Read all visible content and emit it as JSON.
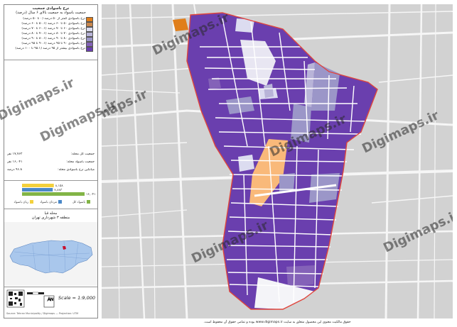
{
  "colors": {
    "map_background": "#d2d2d2",
    "roads": "#f6f6f6",
    "boundary": "#e0463d",
    "class_1": "#e07e1a",
    "class_2": "#c8874e",
    "class_3": "#dcdcf0",
    "class_4": "#b8b4d8",
    "class_5": "#9b96c8",
    "class_6": "#8462b8",
    "class_7": "#6a3fae",
    "built_up": "#ffffff",
    "orange_parcel": "#f9b97a",
    "bar_yellow": "#f3d03c",
    "bar_blue": "#4a88c8",
    "bar_green": "#82b446"
  },
  "legend": {
    "title": "نرخ باسوادی جمعیت",
    "subtitle": "جمعیت باسواد به جمعیت بالای ۶ سال (درصد)",
    "items": [
      {
        "label": "نرخ باسوادی کمتر از ۵۰ درصد (۰ تا ۵۰ درصد)",
        "color_key": "class_1"
      },
      {
        "label": "نرخ باسوادی ۵۰ تا ۶۰ درصد (۵۰.۱ تا ۶۰ درصد)",
        "color_key": "class_2"
      },
      {
        "label": "نرخ باسوادی ۶۰ تا ۷۰ درصد (۶۰.۱ تا ۷۰ درصد)",
        "color_key": "class_3"
      },
      {
        "label": "نرخ باسوادی ۷۰ تا ۸۰ درصد (۷۰.۱ تا ۸۰ درصد)",
        "color_key": "class_4"
      },
      {
        "label": "نرخ باسوادی ۸۰ تا ۹۰ درصد (۸۰.۱ تا ۹۰ درصد)",
        "color_key": "class_5"
      },
      {
        "label": "نرخ باسوادی ۹۰ تا ۹۵ درصد (۹۰.۱ تا ۹۵ درصد)",
        "color_key": "class_6"
      },
      {
        "label": "نرخ باسوادی بیشتر از ۹۵ درصد (۹۵.۱ تا ۱۰۰ درصد)",
        "color_key": "class_7"
      }
    ]
  },
  "stats": {
    "rows": [
      {
        "label": "جمعیت کل محله:",
        "value": "۱۷,۷۶۲ نفر"
      },
      {
        "label": "جمعیت باسواد محله:",
        "value": "۱۶,۰۴۱ نفر"
      },
      {
        "label": "میانگین نرخ باسوادی محله:",
        "value": "۹۶.۸ درصد"
      }
    ]
  },
  "bar_chart": {
    "type": "bar",
    "bars": [
      {
        "label": "زنان باسواد",
        "value_text": "۸,۱۵۸",
        "value": 8158,
        "color_key": "bar_yellow"
      },
      {
        "label": "مردان باسواد",
        "value_text": "۷,۸۸۳",
        "value": 7883,
        "color_key": "bar_blue"
      },
      {
        "label": "باسواد کل",
        "value_text": "۱۶,۰۴۱",
        "value": 16041,
        "color_key": "bar_green"
      }
    ]
  },
  "locator": {
    "title": "محله قبا",
    "subtitle": "منطقه ۳ شهرداری تهران"
  },
  "scale": {
    "text": "Scale = 1:9,000",
    "north": "N",
    "copyright": "Source: Tehran Municipality / Digimaps — Projection: UTM"
  },
  "watermark": "Digimaps.ir",
  "footer": "حقوق مالکیت معنوی این محصول متعلق به سایت www.digimaps.ir بوده و تمامی حقوق آن محفوظ است."
}
